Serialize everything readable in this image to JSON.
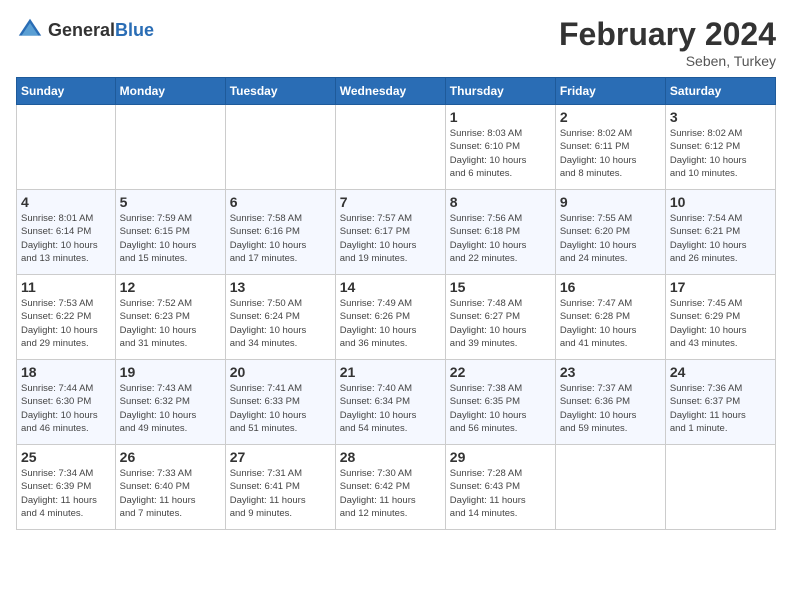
{
  "header": {
    "logo_general": "General",
    "logo_blue": "Blue",
    "month_year": "February 2024",
    "location": "Seben, Turkey"
  },
  "weekdays": [
    "Sunday",
    "Monday",
    "Tuesday",
    "Wednesday",
    "Thursday",
    "Friday",
    "Saturday"
  ],
  "weeks": [
    [
      {
        "day": "",
        "info": ""
      },
      {
        "day": "",
        "info": ""
      },
      {
        "day": "",
        "info": ""
      },
      {
        "day": "",
        "info": ""
      },
      {
        "day": "1",
        "info": "Sunrise: 8:03 AM\nSunset: 6:10 PM\nDaylight: 10 hours\nand 6 minutes."
      },
      {
        "day": "2",
        "info": "Sunrise: 8:02 AM\nSunset: 6:11 PM\nDaylight: 10 hours\nand 8 minutes."
      },
      {
        "day": "3",
        "info": "Sunrise: 8:02 AM\nSunset: 6:12 PM\nDaylight: 10 hours\nand 10 minutes."
      }
    ],
    [
      {
        "day": "4",
        "info": "Sunrise: 8:01 AM\nSunset: 6:14 PM\nDaylight: 10 hours\nand 13 minutes."
      },
      {
        "day": "5",
        "info": "Sunrise: 7:59 AM\nSunset: 6:15 PM\nDaylight: 10 hours\nand 15 minutes."
      },
      {
        "day": "6",
        "info": "Sunrise: 7:58 AM\nSunset: 6:16 PM\nDaylight: 10 hours\nand 17 minutes."
      },
      {
        "day": "7",
        "info": "Sunrise: 7:57 AM\nSunset: 6:17 PM\nDaylight: 10 hours\nand 19 minutes."
      },
      {
        "day": "8",
        "info": "Sunrise: 7:56 AM\nSunset: 6:18 PM\nDaylight: 10 hours\nand 22 minutes."
      },
      {
        "day": "9",
        "info": "Sunrise: 7:55 AM\nSunset: 6:20 PM\nDaylight: 10 hours\nand 24 minutes."
      },
      {
        "day": "10",
        "info": "Sunrise: 7:54 AM\nSunset: 6:21 PM\nDaylight: 10 hours\nand 26 minutes."
      }
    ],
    [
      {
        "day": "11",
        "info": "Sunrise: 7:53 AM\nSunset: 6:22 PM\nDaylight: 10 hours\nand 29 minutes."
      },
      {
        "day": "12",
        "info": "Sunrise: 7:52 AM\nSunset: 6:23 PM\nDaylight: 10 hours\nand 31 minutes."
      },
      {
        "day": "13",
        "info": "Sunrise: 7:50 AM\nSunset: 6:24 PM\nDaylight: 10 hours\nand 34 minutes."
      },
      {
        "day": "14",
        "info": "Sunrise: 7:49 AM\nSunset: 6:26 PM\nDaylight: 10 hours\nand 36 minutes."
      },
      {
        "day": "15",
        "info": "Sunrise: 7:48 AM\nSunset: 6:27 PM\nDaylight: 10 hours\nand 39 minutes."
      },
      {
        "day": "16",
        "info": "Sunrise: 7:47 AM\nSunset: 6:28 PM\nDaylight: 10 hours\nand 41 minutes."
      },
      {
        "day": "17",
        "info": "Sunrise: 7:45 AM\nSunset: 6:29 PM\nDaylight: 10 hours\nand 43 minutes."
      }
    ],
    [
      {
        "day": "18",
        "info": "Sunrise: 7:44 AM\nSunset: 6:30 PM\nDaylight: 10 hours\nand 46 minutes."
      },
      {
        "day": "19",
        "info": "Sunrise: 7:43 AM\nSunset: 6:32 PM\nDaylight: 10 hours\nand 49 minutes."
      },
      {
        "day": "20",
        "info": "Sunrise: 7:41 AM\nSunset: 6:33 PM\nDaylight: 10 hours\nand 51 minutes."
      },
      {
        "day": "21",
        "info": "Sunrise: 7:40 AM\nSunset: 6:34 PM\nDaylight: 10 hours\nand 54 minutes."
      },
      {
        "day": "22",
        "info": "Sunrise: 7:38 AM\nSunset: 6:35 PM\nDaylight: 10 hours\nand 56 minutes."
      },
      {
        "day": "23",
        "info": "Sunrise: 7:37 AM\nSunset: 6:36 PM\nDaylight: 10 hours\nand 59 minutes."
      },
      {
        "day": "24",
        "info": "Sunrise: 7:36 AM\nSunset: 6:37 PM\nDaylight: 11 hours\nand 1 minute."
      }
    ],
    [
      {
        "day": "25",
        "info": "Sunrise: 7:34 AM\nSunset: 6:39 PM\nDaylight: 11 hours\nand 4 minutes."
      },
      {
        "day": "26",
        "info": "Sunrise: 7:33 AM\nSunset: 6:40 PM\nDaylight: 11 hours\nand 7 minutes."
      },
      {
        "day": "27",
        "info": "Sunrise: 7:31 AM\nSunset: 6:41 PM\nDaylight: 11 hours\nand 9 minutes."
      },
      {
        "day": "28",
        "info": "Sunrise: 7:30 AM\nSunset: 6:42 PM\nDaylight: 11 hours\nand 12 minutes."
      },
      {
        "day": "29",
        "info": "Sunrise: 7:28 AM\nSunset: 6:43 PM\nDaylight: 11 hours\nand 14 minutes."
      },
      {
        "day": "",
        "info": ""
      },
      {
        "day": "",
        "info": ""
      }
    ]
  ]
}
